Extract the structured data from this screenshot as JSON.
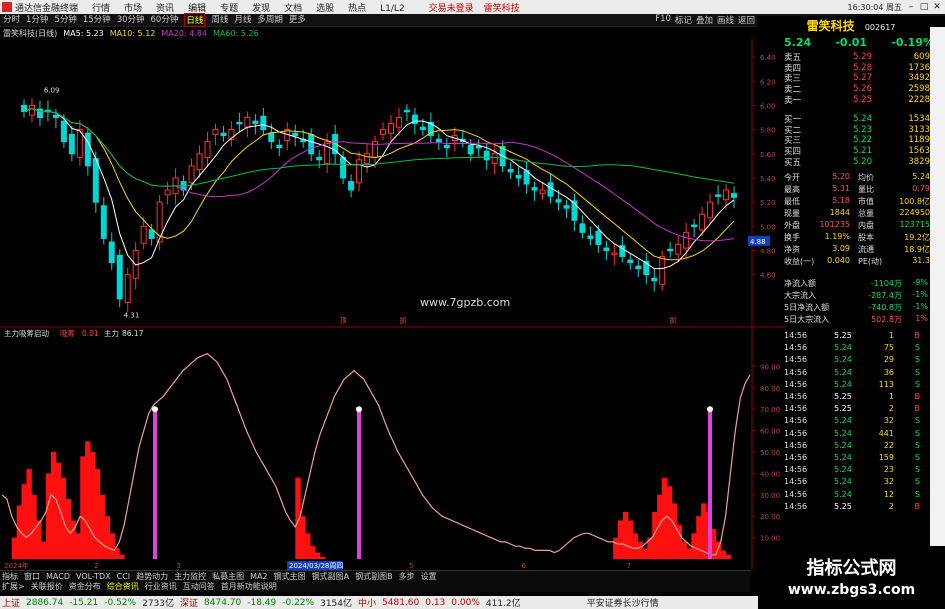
{
  "titlebar": {
    "app_title": "通达信金融终端",
    "menus": [
      "行情",
      "市场",
      "资讯",
      "编辑",
      "专题",
      "发现",
      "文档",
      "选股",
      "热点",
      "L1/L2"
    ],
    "login_text": "交易未登录",
    "login_alt": "雷笑科技",
    "clock": "16:30:04 周五"
  },
  "toolbar": {
    "periods": [
      "分时",
      "1分钟",
      "5分钟",
      "15分钟",
      "30分钟",
      "60分钟",
      "日线",
      "周线",
      "月线",
      "多周期",
      "更多"
    ],
    "active_period": "日线",
    "right_items": [
      "F10",
      "标记",
      "叠加",
      "画线",
      "返回"
    ]
  },
  "main_header": {
    "stock": "雷笑科技(日线)",
    "ma5": "MA5: 5.23",
    "ma10": "MA10: 5.12",
    "ma20": "MA20: 4.84",
    "ma60": "MA60: 5.26"
  },
  "indicator_header": {
    "name": "主力吸筹启动",
    "label1": "吸筹",
    "val1": "0.01",
    "label2": "主力",
    "val2": "86.17"
  },
  "price_axis": [
    "6.40",
    "6.20",
    "6.00",
    "5.80",
    "5.60",
    "5.40",
    "5.20",
    "5.00",
    "4.80",
    "4.60"
  ],
  "indicator_axis": [
    "90.00",
    "80.00",
    "70.00",
    "60.00",
    "50.00",
    "40.00",
    "30.00",
    "20.00",
    "10.00"
  ],
  "date_axis": [
    "2024年",
    "2",
    "3",
    "2024/03/28周四",
    "5",
    "6",
    "7"
  ],
  "chart_labels": {
    "high": "6.09",
    "low": "4.31",
    "current_price_tag": "4.88",
    "markers": [
      "顶",
      "抓",
      "抓"
    ]
  },
  "watermark_center": "www.7gpzb.com",
  "stock_panel": {
    "name": "雷笑科技",
    "code": "002617",
    "price": "5.24",
    "change": "-0.01",
    "pct": "-0.19%"
  },
  "order_book": {
    "asks": [
      {
        "label": "卖五",
        "price": "5.29",
        "vol": "609"
      },
      {
        "label": "卖四",
        "price": "5.28",
        "vol": "1736"
      },
      {
        "label": "卖三",
        "price": "5.27",
        "vol": "3492"
      },
      {
        "label": "卖二",
        "price": "5.26",
        "vol": "2598"
      },
      {
        "label": "卖一",
        "price": "5.25",
        "vol": "2228"
      }
    ],
    "bids": [
      {
        "label": "买一",
        "price": "5.24",
        "vol": "1534"
      },
      {
        "label": "买二",
        "price": "5.23",
        "vol": "3133"
      },
      {
        "label": "买三",
        "price": "5.22",
        "vol": "1189"
      },
      {
        "label": "买四",
        "price": "5.21",
        "vol": "1563"
      },
      {
        "label": "买五",
        "price": "5.20",
        "vol": "3829"
      }
    ]
  },
  "stats": [
    {
      "l1": "今开",
      "v1": "5.20",
      "l2": "均价",
      "v2": "5.24"
    },
    {
      "l1": "最高",
      "v1": "5.31",
      "l2": "量比",
      "v2": "0.79"
    },
    {
      "l1": "最低",
      "v1": "5.18",
      "l2": "市值",
      "v2": "100.8亿"
    },
    {
      "l1": "现量",
      "v1": "1844",
      "l2": "总量",
      "v2": "224950"
    },
    {
      "l1": "外盘",
      "v1": "101235",
      "l2": "内盘",
      "v2": "123715"
    },
    {
      "l1": "换手",
      "v1": "1.19%",
      "l2": "股本",
      "v2": "19.2亿"
    },
    {
      "l1": "净资",
      "v1": "3.09",
      "l2": "流通",
      "v2": "18.9亿"
    },
    {
      "l1": "收益(一)",
      "v1": "0.040",
      "l2": "PE(动)",
      "v2": "31.3"
    }
  ],
  "flows": [
    {
      "label": "净流入额",
      "value": "-1104万",
      "pct": "-9%"
    },
    {
      "label": "大宗流入",
      "value": "-287.4万",
      "pct": "-1%"
    },
    {
      "label": "5日净流入额",
      "value": "-740.8万",
      "pct": "-1%"
    },
    {
      "label": "5日大宗流入",
      "value": "502.8万",
      "pct": "1%"
    }
  ],
  "ticks": [
    {
      "t": "14:56",
      "p": "5.25",
      "v": "1",
      "f": "B"
    },
    {
      "t": "14:56",
      "p": "5.24",
      "v": "75",
      "f": "S"
    },
    {
      "t": "14:56",
      "p": "5.24",
      "v": "29",
      "f": "S"
    },
    {
      "t": "14:56",
      "p": "5.24",
      "v": "36",
      "f": "S"
    },
    {
      "t": "14:56",
      "p": "5.24",
      "v": "113",
      "f": "S"
    },
    {
      "t": "14:56",
      "p": "5.25",
      "v": "1",
      "f": "B"
    },
    {
      "t": "14:56",
      "p": "5.25",
      "v": "2",
      "f": "B"
    },
    {
      "t": "14:56",
      "p": "5.24",
      "v": "32",
      "f": "S"
    },
    {
      "t": "14:56",
      "p": "5.24",
      "v": "441",
      "f": "S"
    },
    {
      "t": "14:56",
      "p": "5.24",
      "v": "22",
      "f": "S"
    },
    {
      "t": "14:56",
      "p": "5.24",
      "v": "159",
      "f": "S"
    },
    {
      "t": "14:56",
      "p": "5.24",
      "v": "23",
      "f": "S"
    },
    {
      "t": "14:56",
      "p": "5.24",
      "v": "32",
      "f": "S"
    },
    {
      "t": "14:56",
      "p": "5.24",
      "v": "12",
      "f": "S"
    },
    {
      "t": "14:56",
      "p": "5.25",
      "v": "2",
      "f": "B"
    }
  ],
  "bottom_tabs_1": [
    "指标",
    "窗口",
    "MACD",
    "VOL-TDX",
    "CCI",
    "趋势动力",
    "主力监控",
    "私募主图",
    "MA2",
    "钢式主图",
    "钢式副图A",
    "钢式副图B",
    "多步",
    "设置"
  ],
  "bottom_tabs_2": [
    "扩展>",
    "关联报价",
    "资金分布",
    "综合资讯",
    "行业资讯",
    "互动问答",
    "首月新功能说明"
  ],
  "statusbar": {
    "sh_label": "上证",
    "sh_val": "2886.74",
    "sh_chg": "-15.21",
    "sh_pct": "-0.52%",
    "sh_amt": "2733亿",
    "sz_label": "深证",
    "sz_val": "8474.70",
    "sz_chg": "-18.49",
    "sz_pct": "-0.22%",
    "sz_amt": "3154亿",
    "zx_label": "中小",
    "zx_val": "5481.60",
    "zx_chg": "0.13",
    "zx_pct": "0.00%",
    "zx_amt": "411.2亿",
    "broker": "平安证券长沙行情"
  },
  "site_watermark": {
    "line1": "指标公式网",
    "line2": "www.zbgs3.com"
  },
  "colors": {
    "up": "#ff3030",
    "down": "#00d8d8",
    "ma5": "#ffffff",
    "ma10": "#ffd700",
    "ma20": "#d030d0",
    "ma60": "#00c040",
    "indicator_line": "#f0a090",
    "bar_fill": "#ff1010",
    "signal": "#e040e0"
  },
  "chart_data": [
    {
      "type": "candlestick",
      "title": "雷笑科技(日线)",
      "ylim": [
        4.2,
        6.5
      ],
      "annotations": [
        {
          "label": "6.09",
          "kind": "high"
        },
        {
          "label": "4.31",
          "kind": "low"
        }
      ],
      "series_ma": [
        {
          "name": "MA5",
          "last": 5.23
        },
        {
          "name": "MA10",
          "last": 5.12
        },
        {
          "name": "MA20",
          "last": 4.84
        },
        {
          "name": "MA60",
          "last": 5.26
        }
      ],
      "closes": [
        5.95,
        6.0,
        5.9,
        5.95,
        5.9,
        5.7,
        5.6,
        5.8,
        5.5,
        5.2,
        4.9,
        4.7,
        4.4,
        4.6,
        4.8,
        5.0,
        4.9,
        5.2,
        5.3,
        5.4,
        5.3,
        5.5,
        5.6,
        5.7,
        5.8,
        5.75,
        5.8,
        5.85,
        5.9,
        5.85,
        5.8,
        5.7,
        5.65,
        5.8,
        5.75,
        5.7,
        5.6,
        5.55,
        5.7,
        5.6,
        5.4,
        5.3,
        5.55,
        5.6,
        5.7,
        5.8,
        5.85,
        5.9,
        5.95,
        5.85,
        5.8,
        5.75,
        5.7,
        5.65,
        5.75,
        5.7,
        5.6,
        5.65,
        5.55,
        5.6,
        5.5,
        5.45,
        5.4,
        5.35,
        5.3,
        5.3,
        5.25,
        5.2,
        5.15,
        5.05,
        4.95,
        4.9,
        4.85,
        4.8,
        4.78,
        4.75,
        4.7,
        4.65,
        4.6,
        4.55,
        4.75,
        4.8,
        4.85,
        4.95,
        5.0,
        5.1,
        5.2,
        5.25,
        5.3,
        5.24
      ]
    },
    {
      "type": "bar",
      "title": "主力吸筹启动",
      "ylim": [
        0,
        100
      ],
      "bars": [
        0,
        0,
        10,
        25,
        35,
        42,
        30,
        18,
        8,
        40,
        50,
        45,
        38,
        28,
        18,
        12,
        48,
        55,
        50,
        42,
        30,
        20,
        12,
        5,
        2,
        0,
        0,
        0,
        0,
        0,
        0,
        0,
        0,
        0,
        0,
        0,
        0,
        0,
        0,
        0,
        0,
        0,
        0,
        0,
        0,
        0,
        0,
        0,
        0,
        0,
        0,
        0,
        0,
        0,
        0,
        0,
        0,
        0,
        0,
        0,
        38,
        20,
        12,
        6,
        3,
        1,
        0,
        0,
        0,
        0,
        0,
        0,
        0,
        0,
        0,
        0,
        0,
        0,
        0,
        0,
        0,
        0,
        0,
        0,
        0,
        0,
        0,
        0,
        0,
        0,
        0,
        0,
        0,
        0,
        0,
        0,
        0,
        0,
        0,
        0,
        0,
        0,
        0,
        0,
        0,
        0,
        0,
        0,
        0,
        0,
        0,
        0,
        0,
        0,
        0,
        0,
        0,
        0,
        0,
        0,
        0,
        0,
        0,
        0,
        0,
        10,
        18,
        22,
        18,
        12,
        8,
        5,
        10,
        22,
        30,
        38,
        34,
        26,
        16,
        8,
        5,
        12,
        20,
        26,
        22,
        14,
        8,
        4,
        2,
        0,
        0,
        0,
        0,
        0
      ],
      "line": [
        30,
        28,
        20,
        15,
        12,
        10,
        12,
        15,
        18,
        22,
        30,
        28,
        22,
        15,
        12,
        15,
        20,
        18,
        14,
        10,
        8,
        6,
        5,
        4,
        8,
        16,
        28,
        40,
        52,
        60,
        68,
        72,
        74,
        76,
        79,
        82,
        85,
        88,
        90,
        92,
        94,
        95,
        96,
        94,
        92,
        88,
        84,
        78,
        72,
        66,
        60,
        55,
        50,
        46,
        42,
        38,
        34,
        28,
        22,
        18,
        15,
        20,
        30,
        40,
        50,
        58,
        64,
        70,
        76,
        80,
        84,
        86,
        88,
        86,
        84,
        80,
        76,
        72,
        66,
        60,
        55,
        50,
        46,
        42,
        38,
        34,
        30,
        27,
        24,
        22,
        20,
        19,
        18,
        17,
        16,
        15,
        14,
        13,
        12,
        11,
        10,
        9,
        8,
        8,
        7,
        6,
        6,
        5,
        5,
        4,
        4,
        4,
        4,
        3,
        4,
        6,
        8,
        10,
        11,
        12,
        12,
        11,
        10,
        9,
        8,
        8,
        7,
        7,
        6,
        5,
        5,
        6,
        8,
        10,
        14,
        18,
        20,
        18,
        14,
        10,
        8,
        6,
        5,
        4,
        3,
        2,
        2,
        8,
        20,
        40,
        60,
        75,
        82,
        86
      ],
      "signals": [
        {
          "x": 0.204,
          "label": "吸筹"
        },
        {
          "x": 0.476,
          "label": "吸筹"
        },
        {
          "x": 0.944,
          "label": "吸筹"
        }
      ]
    }
  ]
}
